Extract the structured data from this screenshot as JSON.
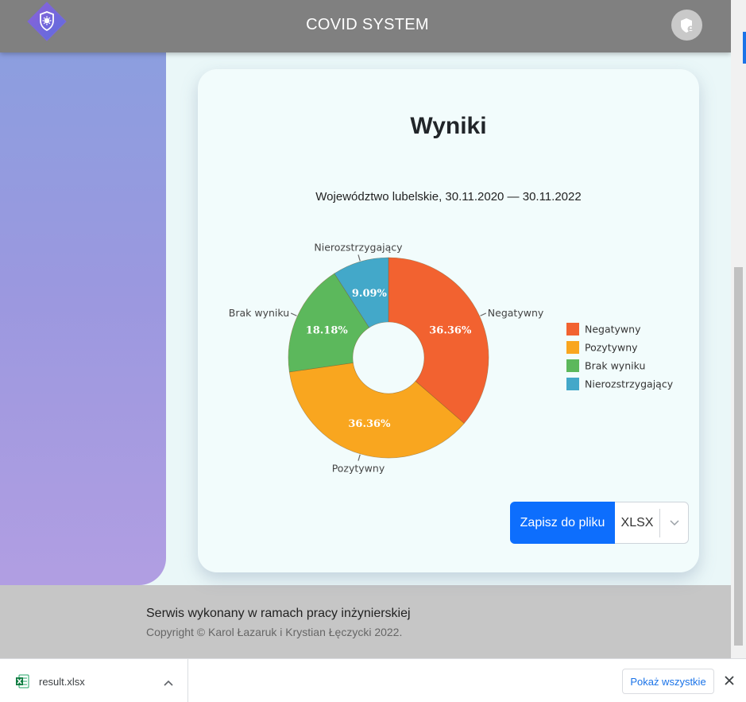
{
  "navbar": {
    "title": "COVID SYSTEM",
    "logo_icon": "virus-shield-icon",
    "user_icon": "user-shield-icon"
  },
  "card": {
    "title": "Wyniki",
    "save_button_label": "Zapisz do pliku",
    "format_value": "XLSX"
  },
  "chart_data": {
    "type": "pie",
    "subtitle": "Województwo lubelskie, 30.11.2020 — 30.11.2022",
    "hole": true,
    "legend_position": "right",
    "slices": [
      {
        "label": "Negatywny",
        "value": 36.36,
        "display": "36.36%",
        "color": "#f26230"
      },
      {
        "label": "Pozytywny",
        "value": 36.36,
        "display": "36.36%",
        "color": "#f9a61f"
      },
      {
        "label": "Brak wyniku",
        "value": 18.18,
        "display": "18.18%",
        "color": "#5cb85c"
      },
      {
        "label": "Nierozstrzygający",
        "value": 9.09,
        "display": "9.09%",
        "color": "#43a8c9"
      }
    ]
  },
  "footer": {
    "line1": "Serwis wykonany w ramach pracy inżynierskiej",
    "line2": "Copyright © Karol Łazaruk i Krystian Łęczycki 2022."
  },
  "download_bar": {
    "file_name": "result.xlsx",
    "show_all_label": "Pokaż wszystkie"
  }
}
